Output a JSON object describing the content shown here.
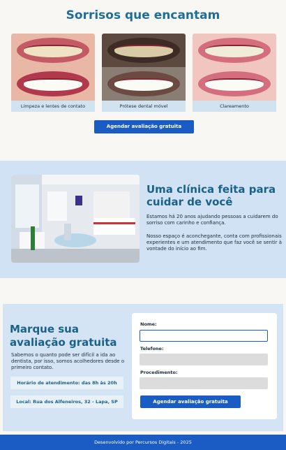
{
  "gallery": {
    "title": "Sorrisos que encantam",
    "cards": [
      {
        "caption": "Limpeza e lentes de contato"
      },
      {
        "caption": "Prótese dental móvel"
      },
      {
        "caption": "Clareamento"
      }
    ],
    "cta_label": "Agendar avaliação gratuita"
  },
  "clinic": {
    "heading": "Uma clínica feita para cuidar de você",
    "paragraph1": "Estamos há 20 anos ajudando pessoas a cuidarem do sorriso com carinho e confiança.",
    "paragraph2": "Nosso espaço é aconchegante,  conta com profissionais experientes e um atendimento que faz você se sentir à vontade do início ao fim."
  },
  "booking": {
    "heading": "Marque sua avaliação gratuita",
    "text": "Sabemos o quanto pode ser difícil a ida ao dentista, por isso, somos acolhedores desde o primeiro contato.",
    "hours": "Horário de atendimento: das 8h às 20h",
    "location": "Local: Rua dos Alfeneiros, 32 - Lapa, SP",
    "form": {
      "name_label": "Nome:",
      "name_value": "",
      "phone_label": "Telefone:",
      "phone_value": "",
      "procedure_label": "Procedimento:",
      "procedure_value": "",
      "submit_label": "Agendar avaliação gratuita"
    }
  },
  "footer": {
    "text": "Desenvolvido por Percursos Digitais - 2025"
  },
  "colors": {
    "accent": "#1a5bc4",
    "heading": "#1d6f96",
    "section_bg": "#d1e2f4"
  }
}
